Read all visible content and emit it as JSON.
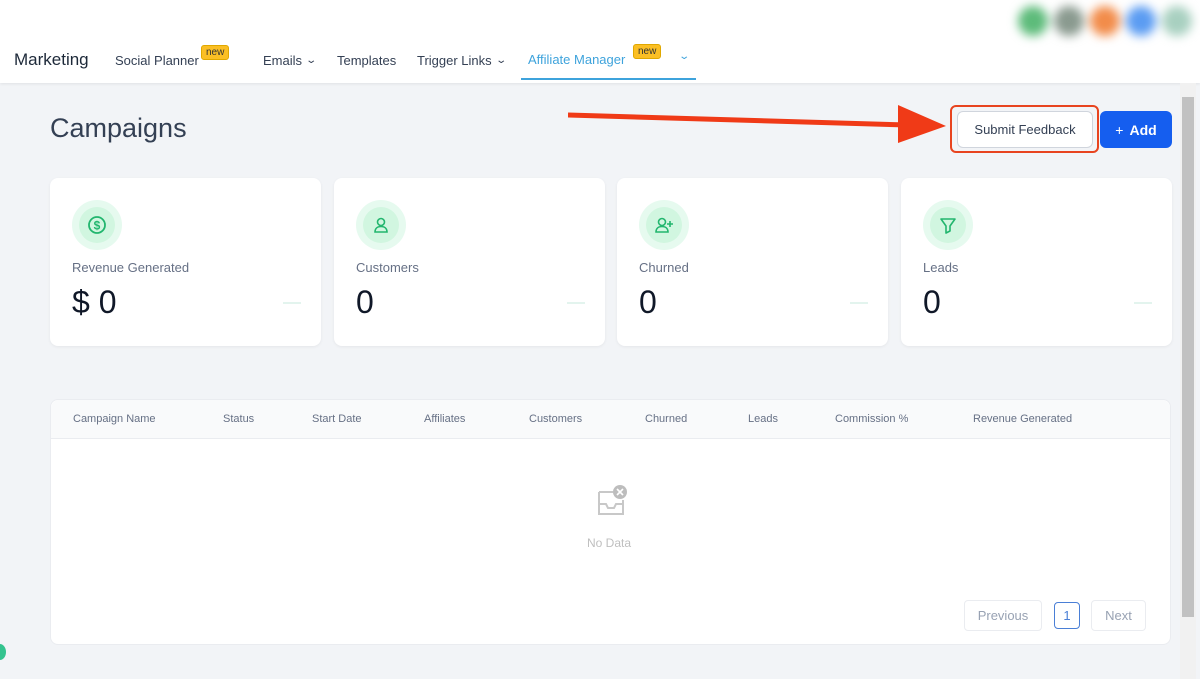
{
  "header": {
    "brand": "Marketing",
    "nav": [
      {
        "label": "Social Planner",
        "badge": "new"
      },
      {
        "label": "Emails"
      },
      {
        "label": "Templates"
      },
      {
        "label": "Trigger Links"
      },
      {
        "label": "Affiliate Manager",
        "badge": "new",
        "active": true
      }
    ]
  },
  "page": {
    "title": "Campaigns",
    "submit_feedback": "Submit Feedback",
    "add": "Add",
    "add_icon": "+"
  },
  "stats": [
    {
      "label": "Revenue Generated",
      "value": "$ 0",
      "icon": "dollar-icon"
    },
    {
      "label": "Customers",
      "value": "0",
      "icon": "user-icon"
    },
    {
      "label": "Churned",
      "value": "0",
      "icon": "user-plus-icon"
    },
    {
      "label": "Leads",
      "value": "0",
      "icon": "funnel-icon"
    }
  ],
  "table": {
    "columns": [
      "Campaign Name",
      "Status",
      "Start Date",
      "Affiliates",
      "Customers",
      "Churned",
      "Leads",
      "Commission %",
      "Revenue Generated"
    ],
    "empty_text": "No Data"
  },
  "pagination": {
    "previous": "Previous",
    "current": "1",
    "next": "Next"
  },
  "colors": {
    "accent": "#155eef",
    "highlight": "#e8441f",
    "active_tab": "#3ea3dc",
    "icon_green": "#22b66e"
  }
}
